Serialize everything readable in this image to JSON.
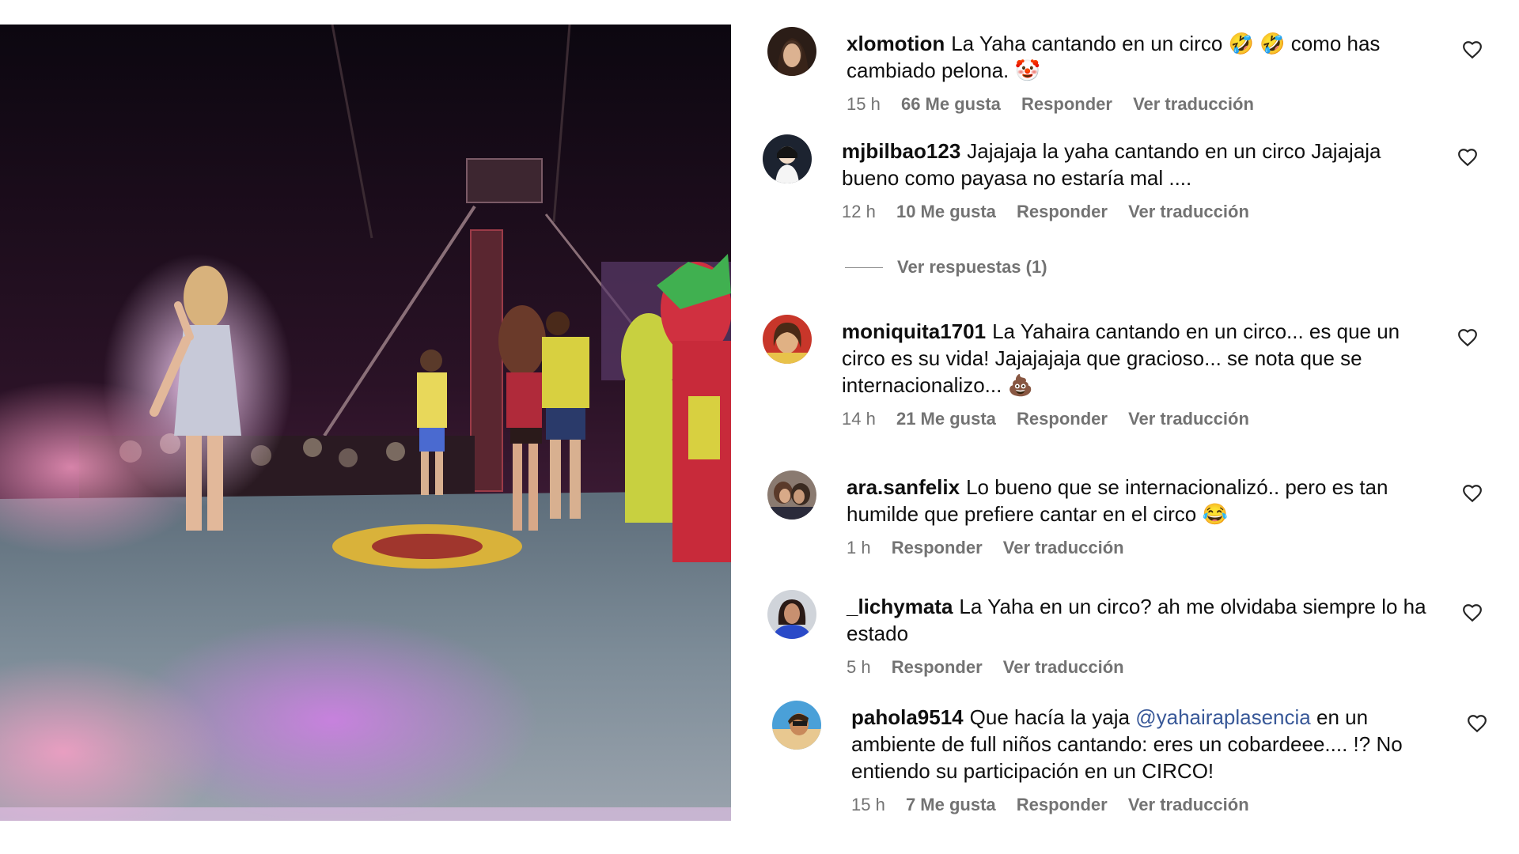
{
  "comments": [
    {
      "username": "xlomotion",
      "text": "La Yaha cantando en un circo 🤣 🤣 como has cambiado pelona. 🤡",
      "time": "15 h",
      "likes": "66 Me gusta",
      "reply": "Responder",
      "translate": "Ver traducción"
    },
    {
      "username": "mjbilbao123",
      "text": "Jajajaja la yaha cantando en un circo Jajajaja bueno como payasa no estaría mal ....",
      "time": "12 h",
      "likes": "10 Me gusta",
      "reply": "Responder",
      "translate": "Ver traducción",
      "replies_label": "Ver respuestas (1)"
    },
    {
      "username": "moniquita1701",
      "text": "La Yahaira cantando en un circo... es que un circo es su vida! Jajajajaja que gracioso... se nota que se internacionalizo... 💩",
      "time": "14 h",
      "likes": "21 Me gusta",
      "reply": "Responder",
      "translate": "Ver traducción"
    },
    {
      "username": "ara.sanfelix",
      "text": "Lo bueno que se internacionalizó.. pero es tan humilde que prefiere cantar en el circo 😂",
      "time": "1 h",
      "reply": "Responder",
      "translate": "Ver traducción"
    },
    {
      "username": "_lichymata",
      "text": "La Yaha en un circo? ah me olvidaba siempre lo ha estado",
      "time": "5 h",
      "reply": "Responder",
      "translate": "Ver traducción"
    },
    {
      "username": "pahola9514",
      "text_before": "Que hacía la yaja",
      "mention": "@yahairaplasencia",
      "text_after": "en un ambiente de full niños cantando: eres un cobardeee.... !? No entiendo su participación en un CIRCO!",
      "time": "15 h",
      "likes": "7 Me gusta",
      "reply": "Responder",
      "translate": "Ver traducción"
    }
  ],
  "icons": {
    "like": "heart-outline-icon"
  },
  "colors": {
    "meta_text": "#737373",
    "mention": "#385898",
    "stage_floor": "#6f7f8c",
    "stage_light": "#c77ad6"
  }
}
